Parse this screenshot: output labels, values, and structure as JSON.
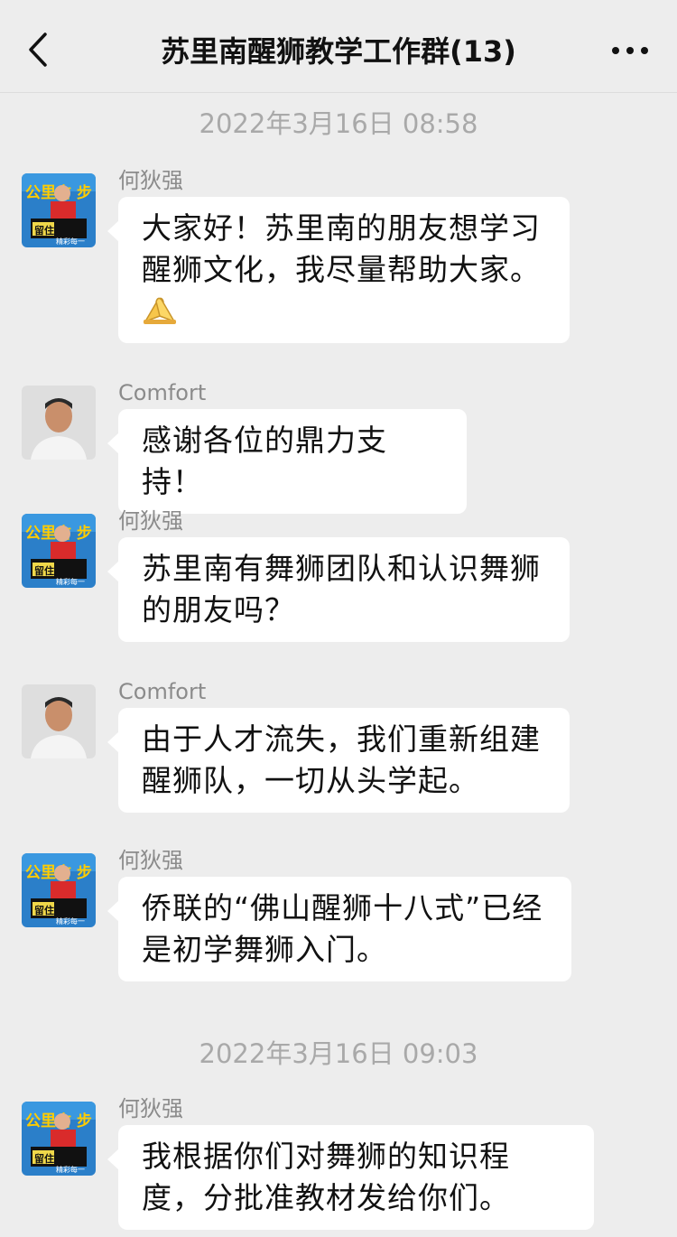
{
  "header": {
    "title": "苏里南醒狮教学工作群(13)",
    "back_icon": "chevron-left-icon",
    "more_icon": "more-dots-icon"
  },
  "timestamps": [
    "2022年3月16日 08:58",
    "2022年3月16日 09:03"
  ],
  "messages": [
    {
      "sender": "何狄强",
      "avatar": "banner-avatar",
      "text": "大家好！苏里南的朋友想学习醒狮文化，我尽量帮助大家。",
      "emoji": "folded-hands-icon"
    },
    {
      "sender": "Comfort",
      "avatar": "portrait-avatar",
      "text": "感谢各位的鼎力支持！"
    },
    {
      "sender": "何狄强",
      "avatar": "banner-avatar",
      "text": "苏里南有舞狮团队和认识舞狮的朋友吗？"
    },
    {
      "sender": "Comfort",
      "avatar": "portrait-avatar",
      "text": "由于人才流失，我们重新组建醒狮队，一切从头学起。"
    },
    {
      "sender": "何狄强",
      "avatar": "banner-avatar",
      "text": "侨联的“佛山醒狮十八式”已经是初学舞狮入门。"
    },
    {
      "sender": "何狄强",
      "avatar": "banner-avatar",
      "text": "我根据你们对舞狮的知识程度，分批准教材发给你们。"
    }
  ],
  "avatar_text": {
    "banner_top": "公里古 步",
    "banner_mid": "留住",
    "banner_bot": "精彩每一"
  }
}
